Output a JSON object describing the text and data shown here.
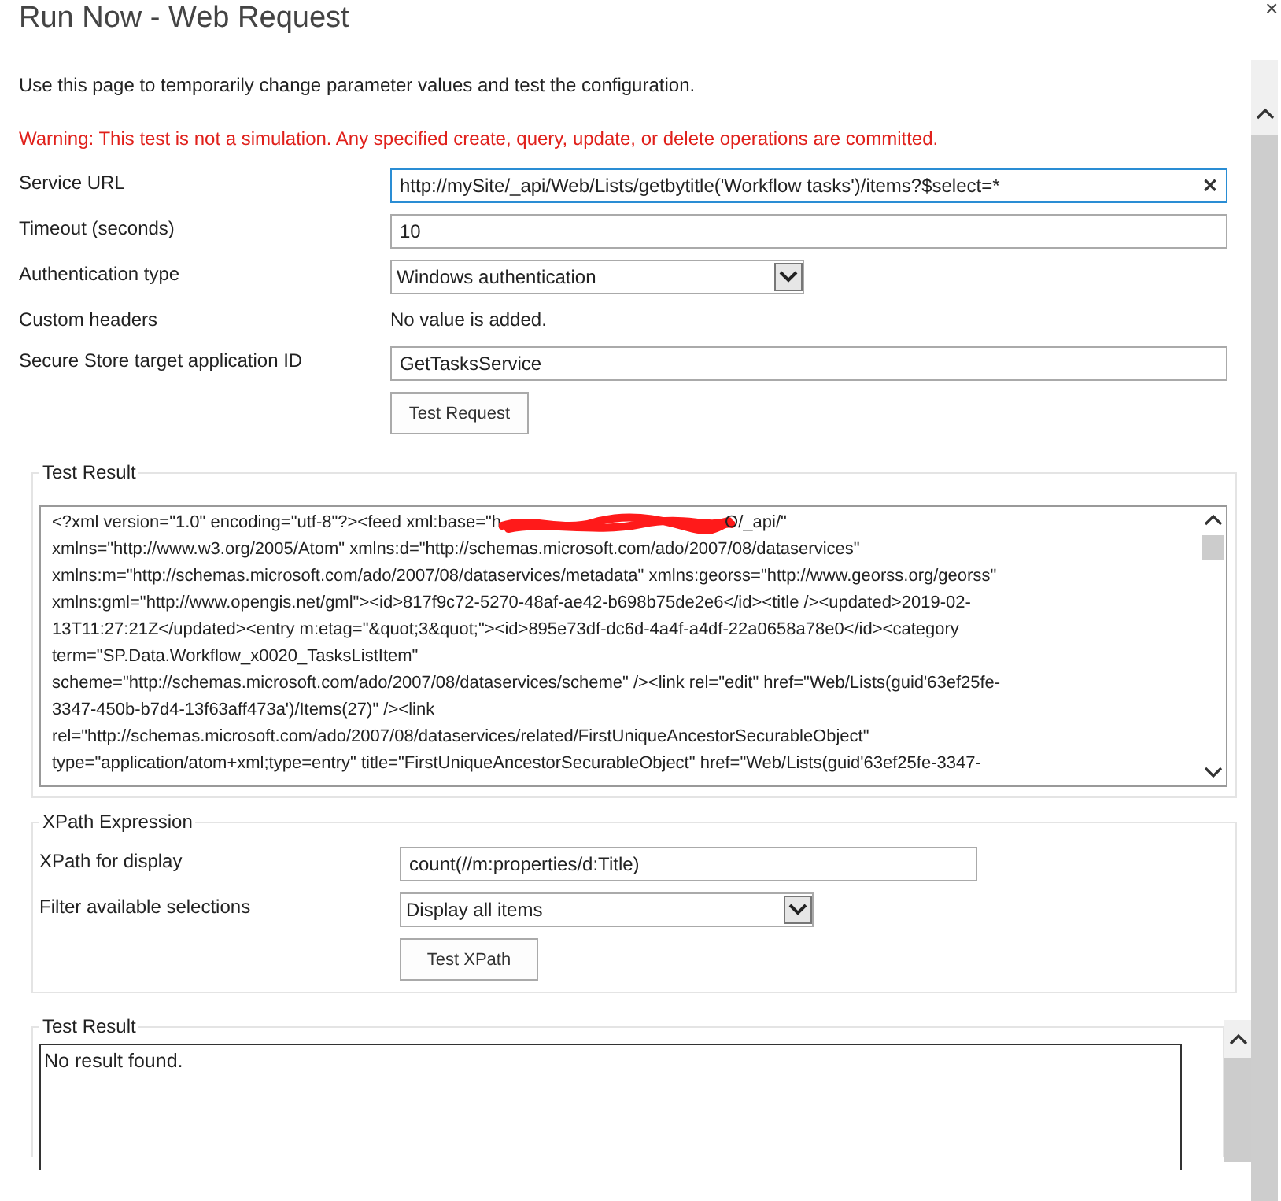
{
  "window": {
    "title": "Run Now - Web Request",
    "close": "×"
  },
  "intro": "Use this page to temporarily change parameter values and test the configuration.",
  "warning": "Warning: This test is not a simulation. Any specified create, query, update, or delete operations are committed.",
  "fields": [
    {
      "kind": "input",
      "label": "Service URL",
      "value": "http://mySite/_api/Web/Lists/getbytitle('Workflow tasks')/items?$select=*",
      "focused": true,
      "clear": "✕"
    },
    {
      "kind": "input",
      "label": "Timeout (seconds)",
      "value": "10",
      "focused": false
    },
    {
      "kind": "select",
      "label": "Authentication type",
      "value": "Windows authentication"
    },
    {
      "kind": "static",
      "label": "Custom headers",
      "value": "No value is added."
    },
    {
      "kind": "input",
      "label": "Secure Store target application ID",
      "value": "GetTasksService",
      "focused": false
    }
  ],
  "test_request_button": "Test Request",
  "test_result": {
    "legend": "Test Result",
    "redacted": true,
    "lines": [
      "<?xml version=\"1.0\" encoding=\"utf-8\"?><feed xml:base=\"h",
      "xmlns=\"http://www.w3.org/2005/Atom\" xmlns:d=\"http://schemas.microsoft.com/ado/2007/08/dataservices\"",
      "xmlns:m=\"http://schemas.microsoft.com/ado/2007/08/dataservices/metadata\" xmlns:georss=\"http://www.georss.org/georss\"",
      "xmlns:gml=\"http://www.opengis.net/gml\"><id>817f9c72-5270-48af-ae42-b698b75de2e6</id><title /><updated>2019-02-",
      "13T11:27:21Z</updated><entry m:etag=\"&quot;3&quot;\"><id>895e73df-dc6d-4a4f-a4df-22a0658a78e0</id><category",
      "term=\"SP.Data.Workflow_x0020_TasksListItem\"",
      "scheme=\"http://schemas.microsoft.com/ado/2007/08/dataservices/scheme\" /><link rel=\"edit\" href=\"Web/Lists(guid'63ef25fe-",
      "3347-450b-b7d4-13f63aff473a')/Items(27)\" /><link",
      "rel=\"http://schemas.microsoft.com/ado/2007/08/dataservices/related/FirstUniqueAncestorSecurableObject\"",
      "type=\"application/atom+xml;type=entry\" title=\"FirstUniqueAncestorSecurableObject\" href=\"Web/Lists(guid'63ef25fe-3347-"
    ],
    "redacted_tail": "O/_api/\""
  },
  "xpath": {
    "legend": "XPath Expression",
    "fields": [
      {
        "kind": "input",
        "label": "XPath for display",
        "value": "count(//m:properties/d:Title)",
        "focused": false
      },
      {
        "kind": "select",
        "label": "Filter available selections",
        "value": "Display all items"
      }
    ],
    "button": "Test XPath"
  },
  "xpath_result": {
    "legend": "Test Result",
    "text": "No result found."
  }
}
